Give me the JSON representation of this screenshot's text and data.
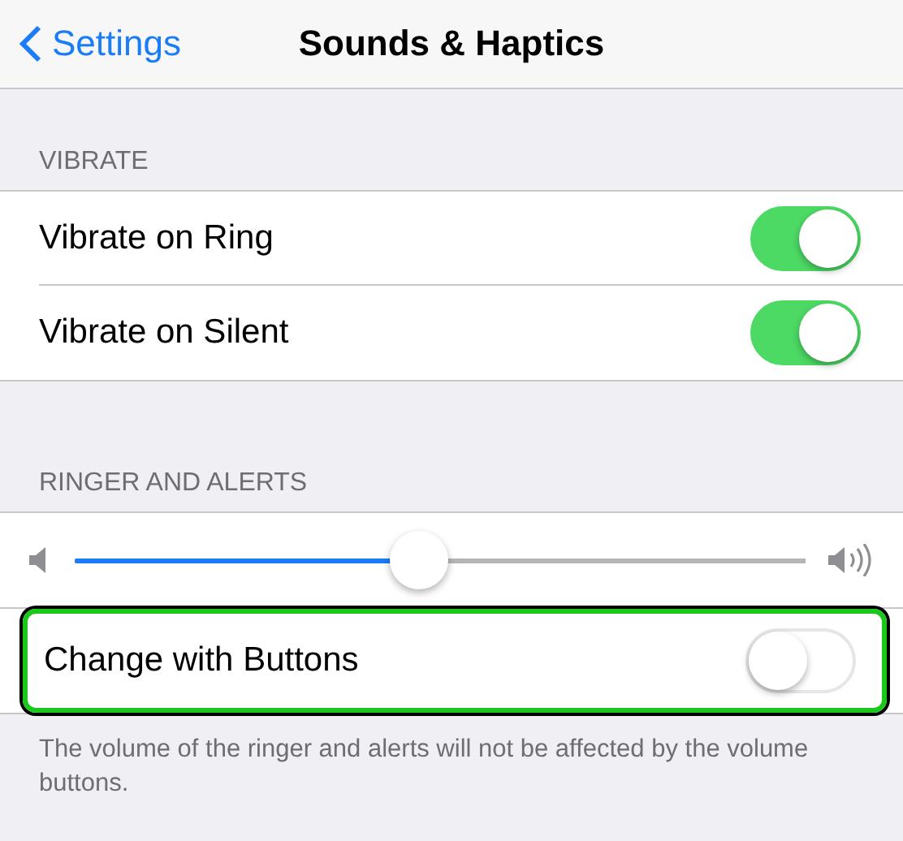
{
  "nav": {
    "back": "Settings",
    "title": "Sounds & Haptics"
  },
  "sections": [
    {
      "header": "VIBRATE",
      "rows": [
        {
          "kind": "toggle",
          "label": "Vibrate on Ring",
          "on": true,
          "highlighted": false
        },
        {
          "kind": "toggle",
          "label": "Vibrate on Silent",
          "on": true,
          "highlighted": false
        }
      ]
    },
    {
      "header": "RINGER AND ALERTS",
      "rows": [
        {
          "kind": "slider",
          "level": 0.47
        },
        {
          "kind": "toggle",
          "label": "Change with Buttons",
          "on": false,
          "highlighted": true
        }
      ],
      "footer": "The volume of the ringer and alerts will not be affected by the volume buttons."
    }
  ]
}
